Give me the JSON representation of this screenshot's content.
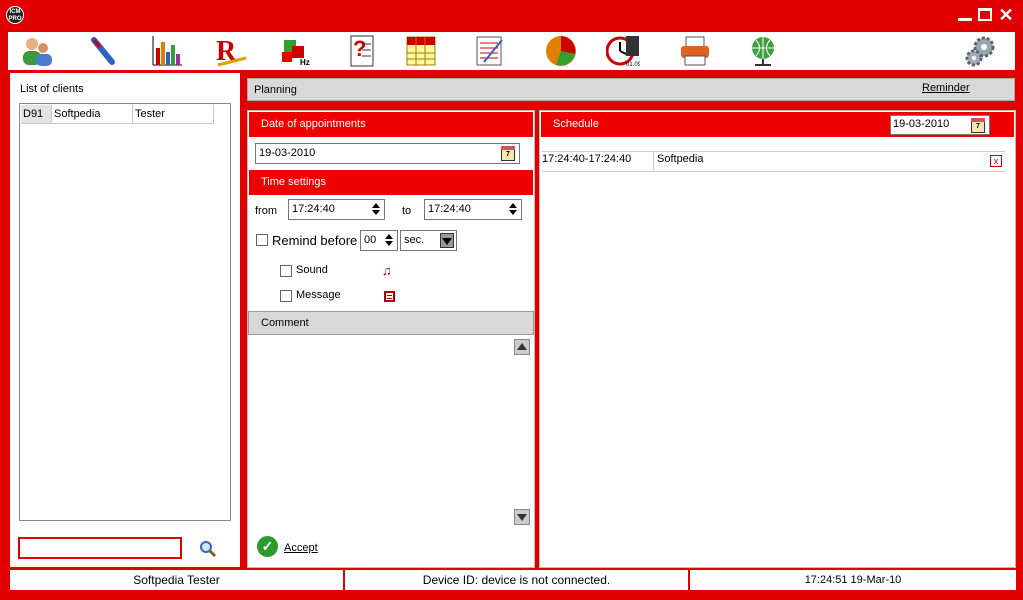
{
  "window": {
    "logo_text": "ICM PRO"
  },
  "toolbar": {
    "icons": [
      "clients-icon",
      "probe-icon",
      "bar-chart-icon",
      "rx-icon",
      "puzzle-hz-icon",
      "questionnaire-icon",
      "grid-table-icon",
      "notepad-icon",
      "pie-chart-icon",
      "clock-icon",
      "printer-icon",
      "globe-network-icon",
      "settings-gears-icon"
    ]
  },
  "clients": {
    "title": "List of clients",
    "rows": [
      {
        "id": "D91",
        "first": "Softpedia",
        "last": "Tester"
      }
    ],
    "search_value": ""
  },
  "planning": {
    "label": "Planning",
    "reminder_link": "Reminder"
  },
  "form": {
    "date_header": "Date of appointments",
    "date_value": "19-03-2010",
    "time_header": "Time settings",
    "from_label": "from",
    "from_value": "17:24:40",
    "to_label": "to",
    "to_value": "17:24:40",
    "remind_label": "Remind before",
    "remind_value": "00",
    "remind_unit": "sec.",
    "sound_label": "Sound",
    "message_label": "Message",
    "comment_header": "Comment",
    "accept_label": "Accept"
  },
  "schedule": {
    "header": "Schedule",
    "date_value": "19-03-2010",
    "entries": [
      {
        "time": "17:24:40-17:24:40",
        "client": "Softpedia"
      }
    ]
  },
  "statusbar": {
    "user": "Softpedia Tester",
    "device": "Device ID: device is not connected.",
    "datetime": "17:24:51  19-Mar-10"
  }
}
